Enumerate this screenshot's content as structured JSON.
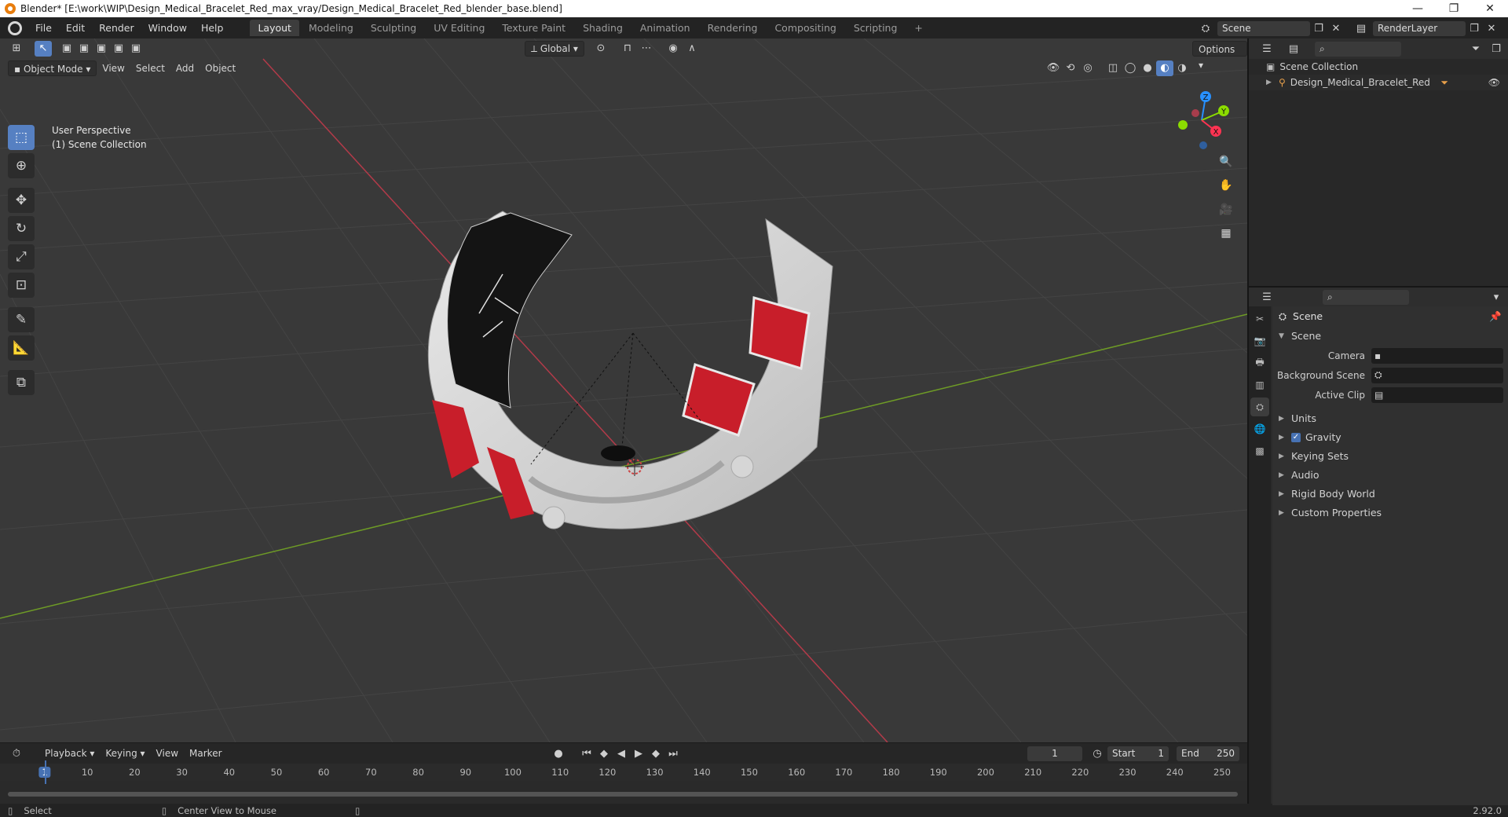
{
  "window": {
    "title": "Blender* [E:\\work\\WIP\\Design_Medical_Bracelet_Red_max_vray/Design_Medical_Bracelet_Red_blender_base.blend]",
    "controls": [
      "—",
      "❐",
      "✕"
    ]
  },
  "menubar": {
    "menus": [
      "File",
      "Edit",
      "Render",
      "Window",
      "Help"
    ],
    "workspaces": [
      "Layout",
      "Modeling",
      "Sculpting",
      "UV Editing",
      "Texture Paint",
      "Shading",
      "Animation",
      "Rendering",
      "Compositing",
      "Scripting"
    ],
    "active_workspace": "Layout",
    "add_tab": "+",
    "scene": "Scene",
    "render_layer": "RenderLayer"
  },
  "viewport": {
    "mode": "Object Mode",
    "menus": [
      "View",
      "Select",
      "Add",
      "Object"
    ],
    "transform_orientation": "Global",
    "options_label": "Options",
    "overlay_line1": "User Perspective",
    "overlay_line2": "(1) Scene Collection",
    "gizmo_axes": {
      "x": "X",
      "y": "Y",
      "z": "Z"
    },
    "colors": {
      "x_axis": "#ff3352",
      "y_axis": "#8bdc00",
      "z_axis": "#2890ff",
      "grid": "#444444",
      "background": "#393939",
      "accent": "#5680c2"
    }
  },
  "tools": [
    "select-box",
    "cursor",
    "move",
    "rotate",
    "scale",
    "transform",
    "annotate",
    "measure",
    "add-cube"
  ],
  "timeline": {
    "menus": [
      "Playback",
      "Keying",
      "View",
      "Marker"
    ],
    "current_frame": "1",
    "start_label": "Start",
    "start_value": "1",
    "end_label": "End",
    "end_value": "250",
    "ticks": [
      "1",
      "10",
      "20",
      "30",
      "40",
      "50",
      "60",
      "70",
      "80",
      "90",
      "100",
      "110",
      "120",
      "130",
      "140",
      "150",
      "160",
      "170",
      "180",
      "190",
      "200",
      "210",
      "220",
      "230",
      "240",
      "250"
    ]
  },
  "statusbar": {
    "select": "Select",
    "center_view": "Center View to Mouse",
    "version": "2.92.0"
  },
  "outliner": {
    "root": "Scene Collection",
    "items": [
      {
        "label": "Design_Medical_Bracelet_Red"
      }
    ]
  },
  "properties": {
    "context": "Scene",
    "panel": "Scene",
    "fields": [
      {
        "label": "Camera",
        "value": ""
      },
      {
        "label": "Background Scene",
        "value": ""
      },
      {
        "label": "Active Clip",
        "value": ""
      }
    ],
    "subpanels": [
      "Units",
      "Gravity",
      "Keying Sets",
      "Audio",
      "Rigid Body World",
      "Custom Properties"
    ],
    "gravity_checked": true
  }
}
